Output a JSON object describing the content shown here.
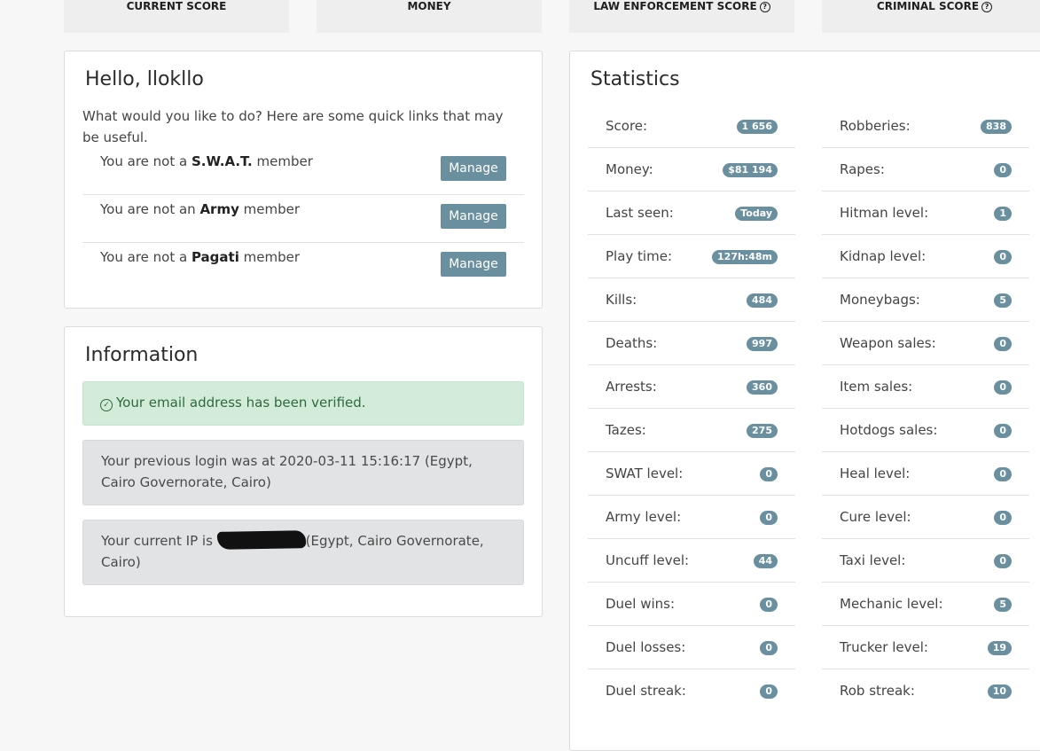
{
  "top_scores": [
    {
      "label": "CURRENT SCORE",
      "help": false
    },
    {
      "label": "MONEY",
      "help": false
    },
    {
      "label": "LAW ENFORCEMENT SCORE",
      "help": true
    },
    {
      "label": "CRIMINAL SCORE",
      "help": true
    }
  ],
  "hello": {
    "title": "Hello, llokllo",
    "intro": "What would you like to do? Here are some quick links that may be useful.",
    "rows": [
      {
        "prefix": "You are not a ",
        "org": "S.W.A.T.",
        "suffix": " member",
        "button": "Manage"
      },
      {
        "prefix": "You are not an ",
        "org": "Army",
        "suffix": " member",
        "button": "Manage"
      },
      {
        "prefix": "You are not a ",
        "org": "Pagati",
        "suffix": " member",
        "button": "Manage"
      }
    ]
  },
  "information": {
    "title": "Information",
    "verified": "Your email address has been verified.",
    "previous_login": "Your previous login was at 2020-03-11 15:16:17 (Egypt, Cairo Governorate, Cairo)",
    "ip_prefix": "Your current IP is ",
    "ip_suffix": "(Egypt, Cairo Governorate, Cairo)"
  },
  "statistics": {
    "title": "Statistics",
    "left": [
      {
        "label": "Score:",
        "value": "1 656"
      },
      {
        "label": "Money:",
        "value": "$81 194"
      },
      {
        "label": "Last seen:",
        "value": "Today"
      },
      {
        "label": "Play time:",
        "value": "127h:48m"
      },
      {
        "label": "Kills:",
        "value": "484"
      },
      {
        "label": "Deaths:",
        "value": "997"
      },
      {
        "label": "Arrests:",
        "value": "360"
      },
      {
        "label": "Tazes:",
        "value": "275"
      },
      {
        "label": "SWAT level:",
        "value": "0"
      },
      {
        "label": "Army level:",
        "value": "0"
      },
      {
        "label": "Uncuff level:",
        "value": "44"
      },
      {
        "label": "Duel wins:",
        "value": "0"
      },
      {
        "label": "Duel losses:",
        "value": "0"
      },
      {
        "label": "Duel streak:",
        "value": "0"
      }
    ],
    "right": [
      {
        "label": "Robberies:",
        "value": "838"
      },
      {
        "label": "Rapes:",
        "value": "0"
      },
      {
        "label": "Hitman level:",
        "value": "1"
      },
      {
        "label": "Kidnap level:",
        "value": "0"
      },
      {
        "label": "Moneybags:",
        "value": "5"
      },
      {
        "label": "Weapon sales:",
        "value": "0"
      },
      {
        "label": "Item sales:",
        "value": "0"
      },
      {
        "label": "Hotdogs sales:",
        "value": "0"
      },
      {
        "label": "Heal level:",
        "value": "0"
      },
      {
        "label": "Cure level:",
        "value": "0"
      },
      {
        "label": "Taxi level:",
        "value": "0"
      },
      {
        "label": "Mechanic level:",
        "value": "5"
      },
      {
        "label": "Trucker level:",
        "value": "19"
      },
      {
        "label": "Rob streak:",
        "value": "10"
      }
    ]
  },
  "colors": {
    "badge": "#6a8f9f",
    "button": "#6a8f9f",
    "success_bg": "#d3ecd9",
    "info_bg": "#e2e3e5"
  }
}
